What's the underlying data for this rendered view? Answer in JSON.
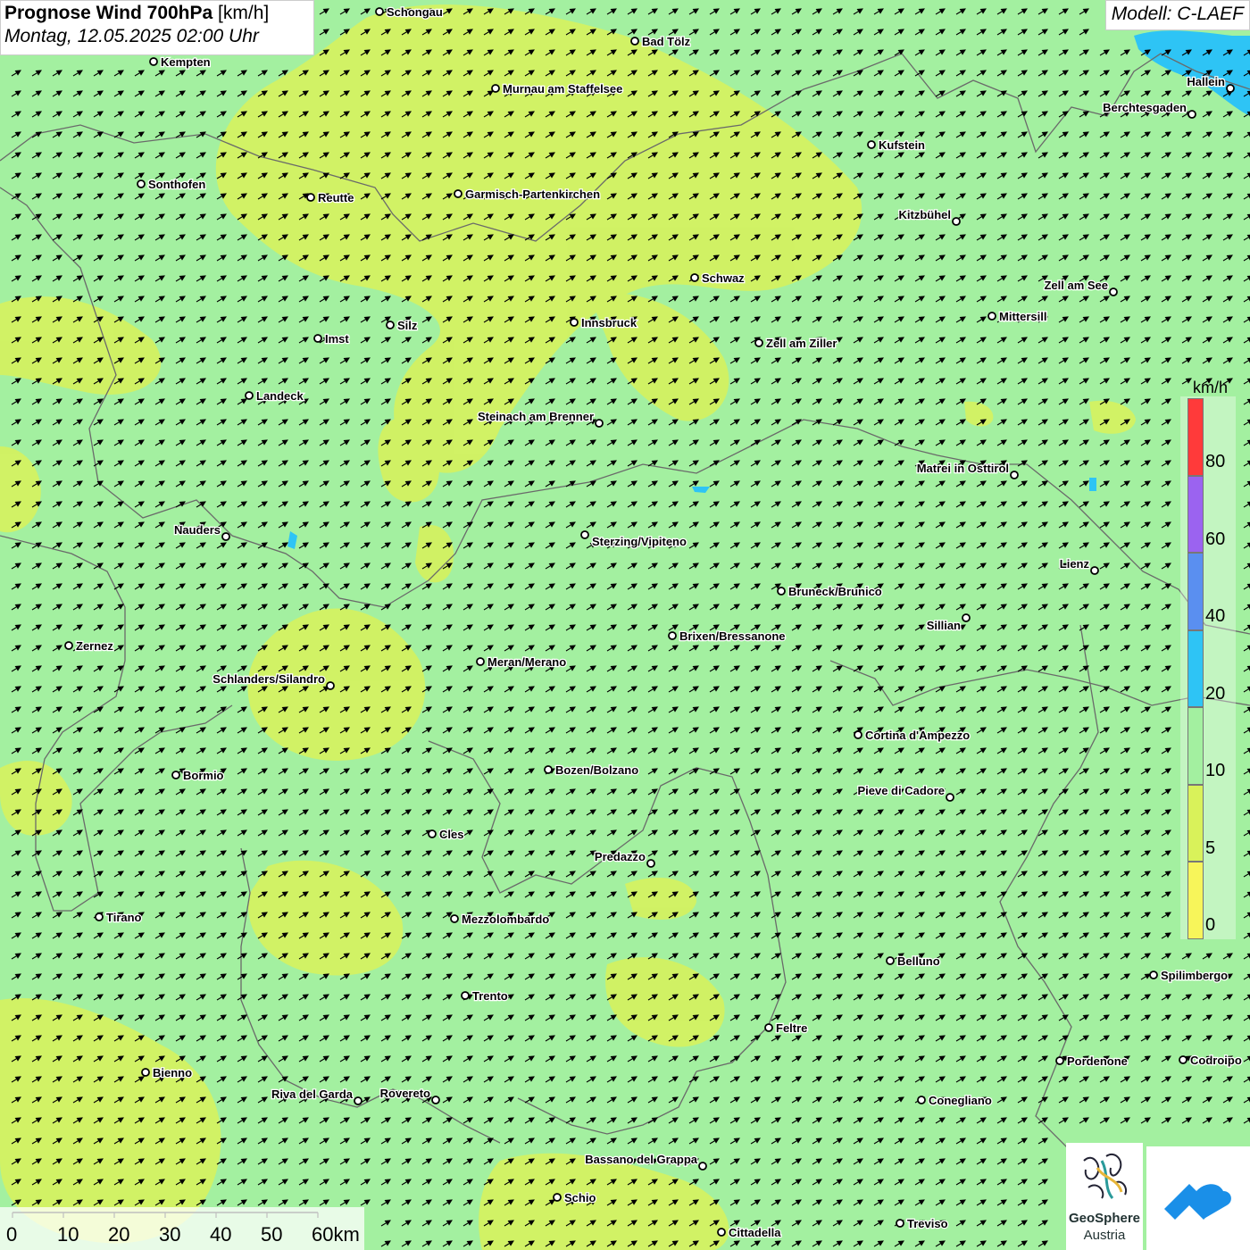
{
  "header": {
    "title_bold": "Prognose Wind 700hPa",
    "title_unit": "[km/h]",
    "datetime": "Montag, 12.05.2025 02:00 Uhr"
  },
  "model": "Modell: C-LAEF",
  "legend": {
    "unit": "km/h",
    "labels": [
      "80",
      "60",
      "40",
      "20",
      "10",
      "5",
      "0"
    ],
    "colors": [
      "#ff3a3a",
      "#9b63f0",
      "#5a8ff0",
      "#2ec4f5",
      "#a3f0a0",
      "#d9f25a",
      "#f7f55a"
    ]
  },
  "scale": {
    "ticks": [
      "0",
      "10",
      "20",
      "30",
      "40",
      "50",
      "60km"
    ]
  },
  "logos": {
    "geosphere_line1": "GeoSphere",
    "geosphere_line2": "Austria"
  },
  "icons": [
    "wind-arrow-icon",
    "city-marker-icon",
    "geosphere-logo-icon",
    "app-logo-icon"
  ],
  "cities": [
    {
      "name": "Schongau"
    },
    {
      "name": "Kempten"
    },
    {
      "name": "Bad Tölz"
    },
    {
      "name": "Murnau am Staffelsee"
    },
    {
      "name": "Hallein"
    },
    {
      "name": "Berchtesgaden"
    },
    {
      "name": "Kufstein"
    },
    {
      "name": "Sonthofen"
    },
    {
      "name": "Reutte"
    },
    {
      "name": "Garmisch-Partenkirchen"
    },
    {
      "name": "Kitzbühel"
    },
    {
      "name": "Schwaz"
    },
    {
      "name": "Zell am See"
    },
    {
      "name": "Mittersill"
    },
    {
      "name": "Innsbruck"
    },
    {
      "name": "Silz"
    },
    {
      "name": "Imst"
    },
    {
      "name": "Zell am Ziller"
    },
    {
      "name": "Landeck"
    },
    {
      "name": "Steinach am Brenner"
    },
    {
      "name": "Matrei in Osttirol"
    },
    {
      "name": "Nauders"
    },
    {
      "name": "Sterzing/Vipiteno"
    },
    {
      "name": "Lienz"
    },
    {
      "name": "Bruneck/Brunico"
    },
    {
      "name": "Sillian"
    },
    {
      "name": "Zernez"
    },
    {
      "name": "Brixen/Bressanone"
    },
    {
      "name": "Meran/Merano"
    },
    {
      "name": "Schlanders/Silandro"
    },
    {
      "name": "Cortina d'Ampezzo"
    },
    {
      "name": "Bozen/Bolzano"
    },
    {
      "name": "Bormio"
    },
    {
      "name": "Pieve di Cadore"
    },
    {
      "name": "Cles"
    },
    {
      "name": "Predazzo"
    },
    {
      "name": "Tirano"
    },
    {
      "name": "Mezzolombardo"
    },
    {
      "name": "Belluno"
    },
    {
      "name": "Spilimbergo"
    },
    {
      "name": "Trento"
    },
    {
      "name": "Feltre"
    },
    {
      "name": "Pordenone"
    },
    {
      "name": "Codroipo"
    },
    {
      "name": "Bienno"
    },
    {
      "name": "Riva del Garda"
    },
    {
      "name": "Rovereto"
    },
    {
      "name": "Conegliano"
    },
    {
      "name": "Bassano del Grappa"
    },
    {
      "name": "Schio"
    },
    {
      "name": "Treviso"
    },
    {
      "name": "Cittadella"
    }
  ]
}
